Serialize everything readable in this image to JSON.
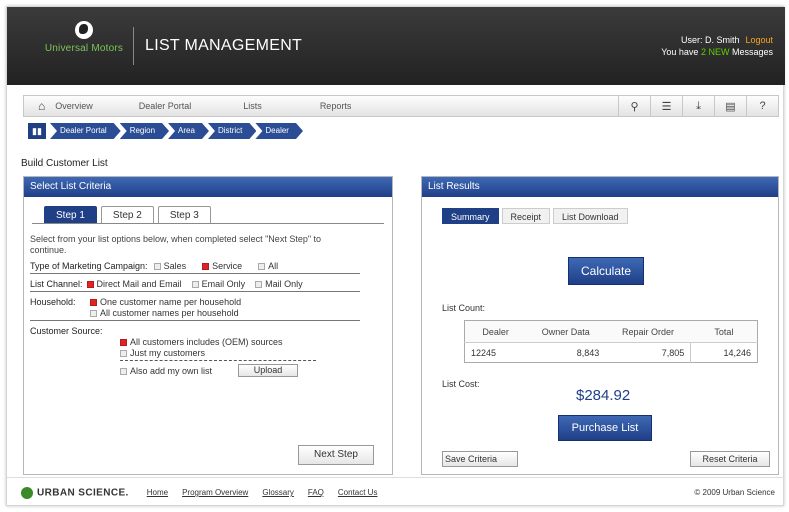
{
  "header": {
    "brand": "Universal Motors",
    "title": "LIST MANAGEMENT",
    "user_line_prefix": "User: D. Smith",
    "logout": "Logout",
    "messages_prefix": "You have",
    "messages_new": "2 NEW",
    "messages_suffix": "Messages"
  },
  "nav": {
    "items": [
      "Overview",
      "Dealer Portal",
      "Lists",
      "Reports"
    ],
    "tool_icons": [
      "search-icon",
      "list-icon",
      "download-icon",
      "print-icon",
      "help-icon"
    ],
    "tool_glyphs": [
      "⚲",
      "☰",
      "⤓",
      "▤",
      "?"
    ]
  },
  "breadcrumb": [
    "Dealer Portal",
    "Region",
    "Area",
    "District",
    "Dealer"
  ],
  "page_title": "Build Customer List",
  "criteria": {
    "header": "Select List Criteria",
    "steps": [
      "Step 1",
      "Step 2",
      "Step 3"
    ],
    "instructions": "Select from your list options below, when completed select \"Next Step\" to continue.",
    "campaign_label": "Type of Marketing Campaign:",
    "campaign_options": [
      {
        "label": "Sales",
        "checked": false
      },
      {
        "label": "Service",
        "checked": true
      },
      {
        "label": "All",
        "checked": false
      }
    ],
    "channel_label": "List Channel:",
    "channel_options": [
      {
        "label": "Direct Mail and Email",
        "checked": true
      },
      {
        "label": "Email Only",
        "checked": false
      },
      {
        "label": "Mail Only",
        "checked": false
      }
    ],
    "household_label": "Household:",
    "household_options": [
      {
        "label": "One customer name per household",
        "checked": true
      },
      {
        "label": "All customer names per household",
        "checked": false
      }
    ],
    "source_label": "Customer Source:",
    "source_options": [
      {
        "label": "All customers includes (OEM) sources",
        "checked": true
      },
      {
        "label": "Just my customers",
        "checked": false
      }
    ],
    "also_add_label": "Also add my own list",
    "upload_label": "Upload",
    "next_label": "Next Step"
  },
  "results": {
    "header": "List Results",
    "tabs": [
      "Summary",
      "Receipt",
      "List Download"
    ],
    "calculate_label": "Calculate",
    "count_label": "List Count:",
    "columns": [
      "Dealer",
      "Owner Data",
      "Repair Order",
      "Total"
    ],
    "row": [
      "12245",
      "8,843",
      "7,805",
      "14,246"
    ],
    "cost_label": "List Cost:",
    "cost": "$284.92",
    "purchase_label": "Purchase List",
    "save_label": "Save Criteria",
    "reset_label": "Reset Criteria"
  },
  "footer": {
    "brand": "URBAN SCIENCE.",
    "links": [
      "Home",
      "Program Overview",
      "Glossary",
      "FAQ",
      "Contact Us"
    ],
    "copyright": "© 2009 Urban Science"
  },
  "colors": {
    "header_bg": "#2a2a2a",
    "panel_header": "#1f3f87",
    "brand_green": "#7cc55a",
    "logout_orange": "#f6a623",
    "new_green": "#5fd000",
    "checked_red": "#e02323"
  }
}
